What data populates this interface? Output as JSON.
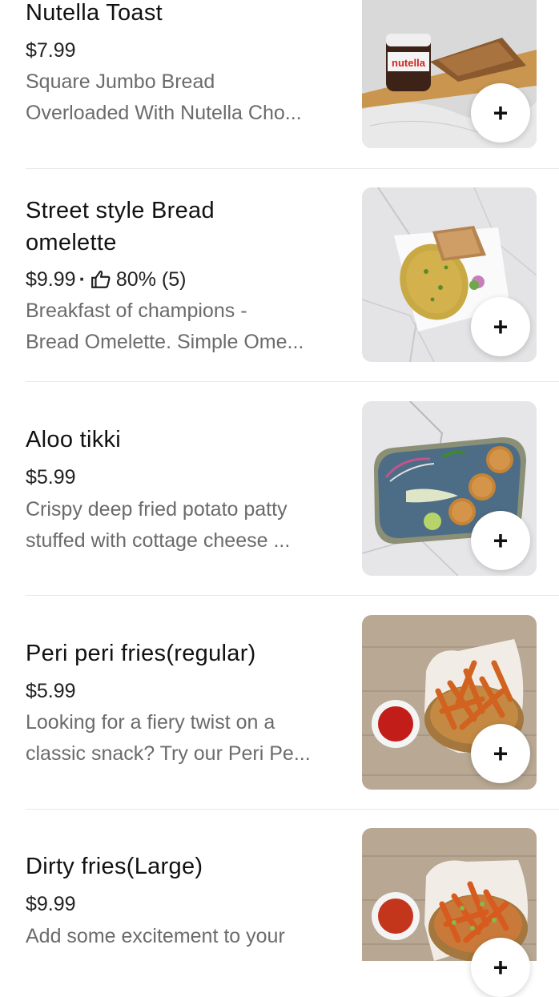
{
  "menu": {
    "items": [
      {
        "title": "Nutella Toast",
        "price": "$7.99",
        "desc_line1": "Square Jumbo Bread",
        "desc_line2": "Overloaded With Nutella Cho...",
        "jar_label": "nutella",
        "add_label": "+"
      },
      {
        "title_line1": "Street style Bread",
        "title_line2": "omelette",
        "price": "$9.99",
        "rating": "80% (5)",
        "rating_fraction": 0.8,
        "desc_line1": "Breakfast of champions -",
        "desc_line2": "Bread Omelette. Simple Ome...",
        "add_label": "+"
      },
      {
        "title": "Aloo tikki",
        "price": "$5.99",
        "desc_line1": "Crispy deep fried potato patty",
        "desc_line2": "stuffed with cottage cheese ...",
        "add_label": "+"
      },
      {
        "title": "Peri peri fries(regular)",
        "price": "$5.99",
        "desc_line1": "Looking for a fiery twist on a",
        "desc_line2": "classic snack? Try our Peri Pe...",
        "add_label": "+"
      },
      {
        "title": "Dirty fries(Large)",
        "price": "$9.99",
        "desc_line1": "Add some excitement to your",
        "add_label": "+"
      }
    ]
  }
}
